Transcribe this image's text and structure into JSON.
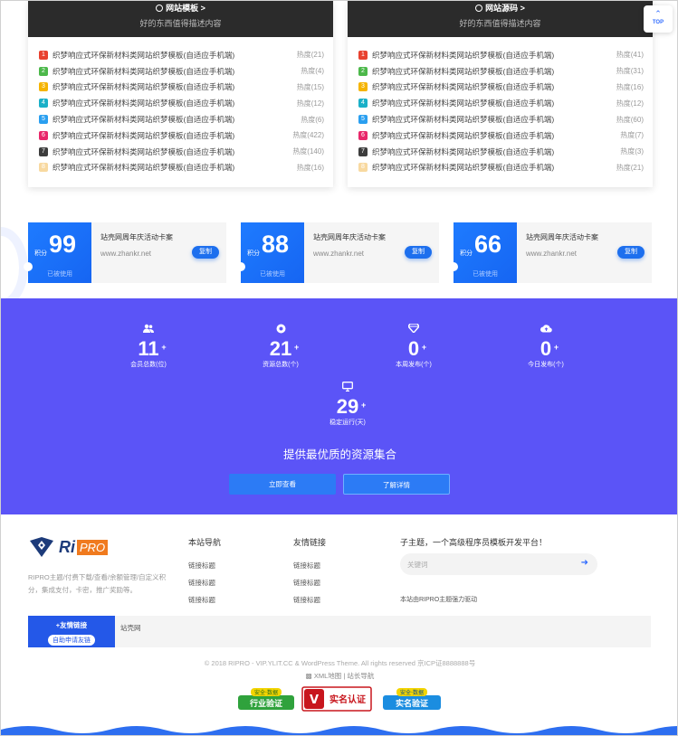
{
  "top_button": {
    "label": "TOP"
  },
  "rank_cards": [
    {
      "title": "网站模板 >",
      "subtitle": "好的东西值得描述内容",
      "items": [
        {
          "num": "1",
          "title": "织梦响应式环保新材料类网站织梦模板(自适应手机端)",
          "heat": "热度(21)"
        },
        {
          "num": "2",
          "title": "织梦响应式环保新材料类网站织梦模板(自适应手机端)",
          "heat": "热度(4)"
        },
        {
          "num": "3",
          "title": "织梦响应式环保新材料类网站织梦模板(自适应手机端)",
          "heat": "热度(15)"
        },
        {
          "num": "4",
          "title": "织梦响应式环保新材料类网站织梦模板(自适应手机端)",
          "heat": "热度(12)"
        },
        {
          "num": "5",
          "title": "织梦响应式环保新材料类网站织梦模板(自适应手机端)",
          "heat": "热度(6)"
        },
        {
          "num": "6",
          "title": "织梦响应式环保新材料类网站织梦模板(自适应手机端)",
          "heat": "热度(422)"
        },
        {
          "num": "7",
          "title": "织梦响应式环保新材料类网站织梦模板(自适应手机端)",
          "heat": "热度(140)"
        },
        {
          "num": "8",
          "title": "织梦响应式环保新材料类网站织梦模板(自适应手机端)",
          "heat": "热度(16)"
        }
      ]
    },
    {
      "title": "网站源码 >",
      "subtitle": "好的东西值得描述内容",
      "items": [
        {
          "num": "1",
          "title": "织梦响应式环保新材料类网站织梦模板(自适应手机端)",
          "heat": "热度(41)"
        },
        {
          "num": "2",
          "title": "织梦响应式环保新材料类网站织梦模板(自适应手机端)",
          "heat": "热度(31)"
        },
        {
          "num": "3",
          "title": "织梦响应式环保新材料类网站织梦模板(自适应手机端)",
          "heat": "热度(16)"
        },
        {
          "num": "4",
          "title": "织梦响应式环保新材料类网站织梦模板(自适应手机端)",
          "heat": "热度(12)"
        },
        {
          "num": "5",
          "title": "织梦响应式环保新材料类网站织梦模板(自适应手机端)",
          "heat": "热度(60)"
        },
        {
          "num": "6",
          "title": "织梦响应式环保新材料类网站织梦模板(自适应手机端)",
          "heat": "热度(7)"
        },
        {
          "num": "7",
          "title": "织梦响应式环保新材料类网站织梦模板(自适应手机端)",
          "heat": "热度(3)"
        },
        {
          "num": "8",
          "title": "织梦响应式环保新材料类网站织梦模板(自适应手机端)",
          "heat": "热度(21)"
        }
      ]
    }
  ],
  "rank_colors": [
    "#e8412f",
    "#4cb84a",
    "#f5b400",
    "#1ab0c8",
    "#2a9ff0",
    "#e8276a",
    "#3d3d3d",
    "#f8d9a0"
  ],
  "coupons": [
    {
      "points_label": "积分",
      "value": "99",
      "title": "站壳网周年庆活动卡案",
      "url": "www.zhankr.net",
      "button": "复制",
      "state": "已被使用"
    },
    {
      "points_label": "积分",
      "value": "88",
      "title": "站壳网周年庆活动卡案",
      "url": "www.zhankr.net",
      "button": "复制",
      "state": "已被使用"
    },
    {
      "points_label": "积分",
      "value": "66",
      "title": "站壳网周年庆活动卡案",
      "url": "www.zhankr.net",
      "button": "复制",
      "state": "已被使用"
    }
  ],
  "stats": {
    "items": [
      {
        "icon": "users-icon",
        "value": "11",
        "plus": "+",
        "label": "会员总数(位)"
      },
      {
        "icon": "resource-icon",
        "value": "21",
        "plus": "+",
        "label": "资源总数(个)"
      },
      {
        "icon": "diamond-icon",
        "value": "0",
        "plus": "+",
        "label": "本周发布(个)"
      },
      {
        "icon": "cloud-upload-icon",
        "value": "0",
        "plus": "+",
        "label": "今日发布(个)"
      },
      {
        "icon": "monitor-icon",
        "value": "29",
        "plus": "+",
        "label": "稳定运行(天)"
      }
    ],
    "title": "提供最优质的资源集合",
    "buttons": [
      "立即查看",
      "了解详情"
    ]
  },
  "footer": {
    "logo_text": "Ri",
    "logo_pro": "PRO",
    "description": "RIPRO主题/付费下载/查看/余额管理/自定义积分，集成支付，卡密，推广奖励等。",
    "col1": {
      "title": "本站导航",
      "links": [
        "链接标题",
        "链接标题",
        "链接标题"
      ]
    },
    "col2": {
      "title": "友情链接",
      "links": [
        "链接标题",
        "链接标题",
        "链接标题"
      ]
    },
    "slogan": "子主题，一个高级程序员模板开发平台！",
    "search_placeholder": "关键词",
    "powered": "本站由RIPRO主题强力驱动",
    "friend_title": "+友情链接",
    "friend_apply": "自助申请友链",
    "friend_link": "站壳网",
    "copyright": "© 2018 RIPRO - VIP.YLIT.CC & WordPress Theme. All rights reserved 京ICP证8888888号",
    "map_links": "XML地图 | 站长导航",
    "badges": [
      "行业验证",
      "实名认证",
      "实名验证"
    ],
    "badge_top": "安全·数据"
  }
}
